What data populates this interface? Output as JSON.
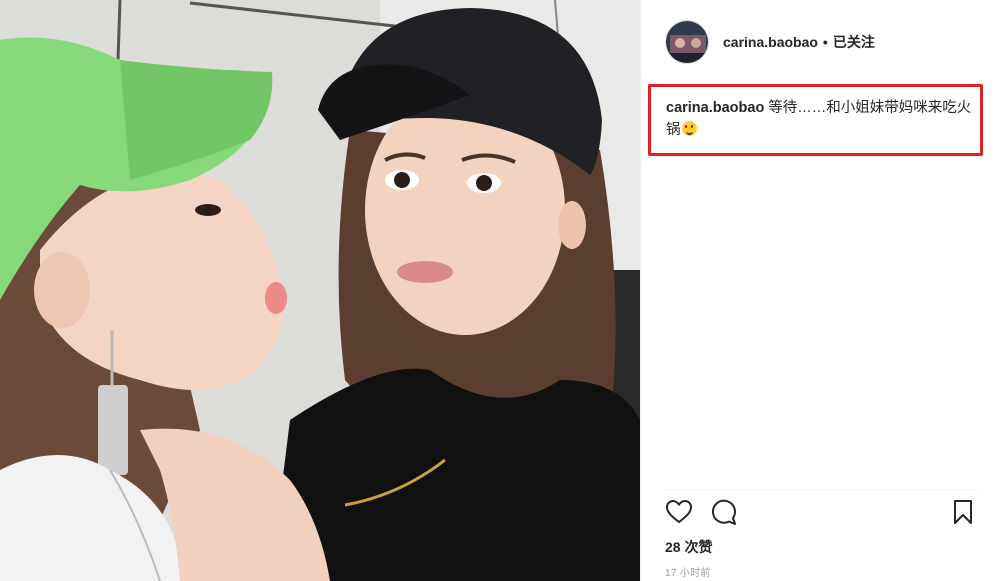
{
  "post": {
    "username": "carina.baobao",
    "separator": "•",
    "follow_label": "已关注",
    "caption_text": "等待……和小姐妹带妈咪来吃火锅",
    "caption_emoji": "yum-face-emoji",
    "likes": "28 次赞",
    "timestamp": "17 小时前"
  },
  "icons": {
    "like": "heart-outline-icon",
    "comment": "comment-bubble-icon",
    "save": "bookmark-icon"
  },
  "colors": {
    "highlight_border": "#e02020",
    "text": "#262626",
    "muted": "#999999"
  }
}
